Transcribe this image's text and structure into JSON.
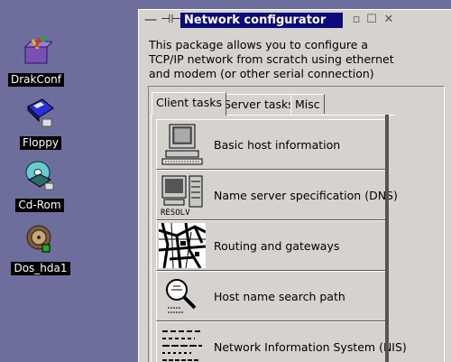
{
  "desktop": {
    "icons": [
      {
        "label": "DrakConf",
        "icon": "drakconf-icon"
      },
      {
        "label": "Floppy",
        "icon": "floppy-icon"
      },
      {
        "label": "Cd-Rom",
        "icon": "cdrom-icon"
      },
      {
        "label": "Dos_hda1",
        "icon": "harddisk-icon"
      }
    ]
  },
  "window": {
    "title": "Network configurator",
    "menu_glyph": "—",
    "pin_glyph": "⊣⊢",
    "minimize_glyph": "▫",
    "maximize_glyph": "☐",
    "close_glyph": "✕",
    "intro_line1": "This package allows you to configure a",
    "intro_line2": "TCP/IP network from scratch using ethernet",
    "intro_line3": "and modem (or other serial connection)",
    "tabs": [
      {
        "label": "Client tasks",
        "active": true
      },
      {
        "label": "Server tasks",
        "active": false
      },
      {
        "label": "Misc",
        "active": false
      }
    ],
    "tasks": [
      {
        "label": "Basic host information",
        "icon": "computer-icon"
      },
      {
        "label": "Name server specification (DNS)",
        "icon": "resolv-icon",
        "icon_text": "RESOLV"
      },
      {
        "label": "Routing and gateways",
        "icon": "map-icon"
      },
      {
        "label": "Host name search path",
        "icon": "magnifier-icon"
      },
      {
        "label": "Network Information System (NIS)",
        "icon": "nis-icon"
      }
    ]
  },
  "colors": {
    "desktop_bg": "#6d6e9c",
    "window_bg": "#d6d3ce",
    "title_bg": "#0b0b7c"
  }
}
